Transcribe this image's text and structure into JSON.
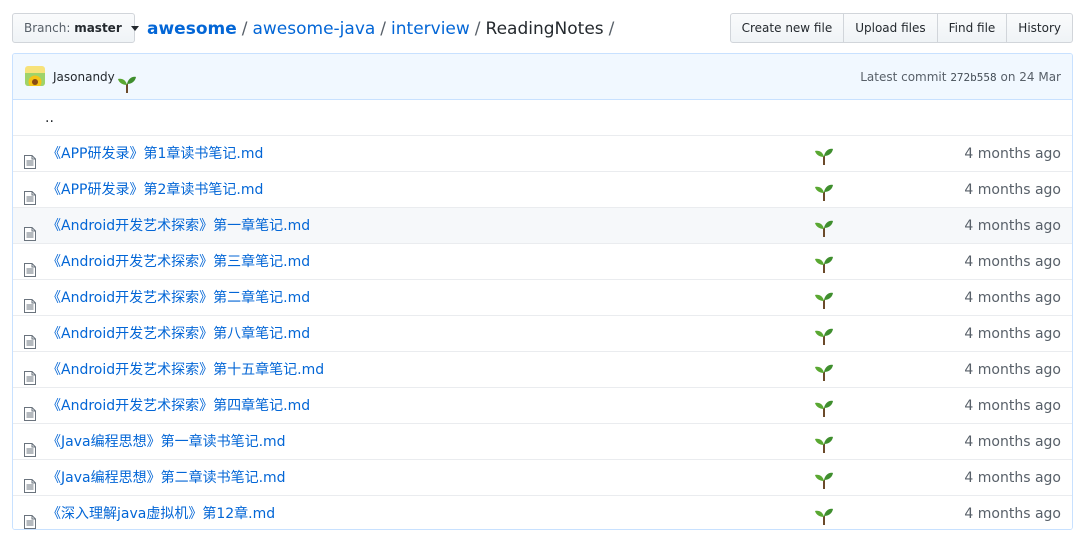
{
  "branch": {
    "prefix": "Branch:",
    "name": "master"
  },
  "breadcrumb": {
    "owner": "awesome",
    "repo": "awesome-java",
    "folder": "interview",
    "current": "ReadingNotes",
    "separator": "/"
  },
  "actions": {
    "create": "Create new file",
    "upload": "Upload files",
    "find": "Find file",
    "history": "History"
  },
  "commit": {
    "author": "Jasonandy",
    "author_emoji": "seedling-icon",
    "prefix": "Latest commit",
    "sha": "272b558",
    "date_text": "on 24 Mar"
  },
  "parent_dir": "..",
  "files": [
    {
      "name": "《APP研发录》第1章读书笔记.md",
      "age": "4 months ago"
    },
    {
      "name": "《APP研发录》第2章读书笔记.md",
      "age": "4 months ago"
    },
    {
      "name": "《Android开发艺术探索》第一章笔记.md",
      "age": "4 months ago"
    },
    {
      "name": "《Android开发艺术探索》第三章笔记.md",
      "age": "4 months ago"
    },
    {
      "name": "《Android开发艺术探索》第二章笔记.md",
      "age": "4 months ago"
    },
    {
      "name": "《Android开发艺术探索》第八章笔记.md",
      "age": "4 months ago"
    },
    {
      "name": "《Android开发艺术探索》第十五章笔记.md",
      "age": "4 months ago"
    },
    {
      "name": "《Android开发艺术探索》第四章笔记.md",
      "age": "4 months ago"
    },
    {
      "name": "《Java编程思想》第一章读书笔记.md",
      "age": "4 months ago"
    },
    {
      "name": "《Java编程思想》第二章读书笔记.md",
      "age": "4 months ago"
    },
    {
      "name": "《深入理解java虚拟机》第12章.md",
      "age": "4 months ago"
    }
  ],
  "colors": {
    "link": "#0366d6",
    "muted": "#586069",
    "commit_bg": "#f1f8ff",
    "border": "#c8e1ff",
    "sprout_green": "#3f8e2e"
  }
}
